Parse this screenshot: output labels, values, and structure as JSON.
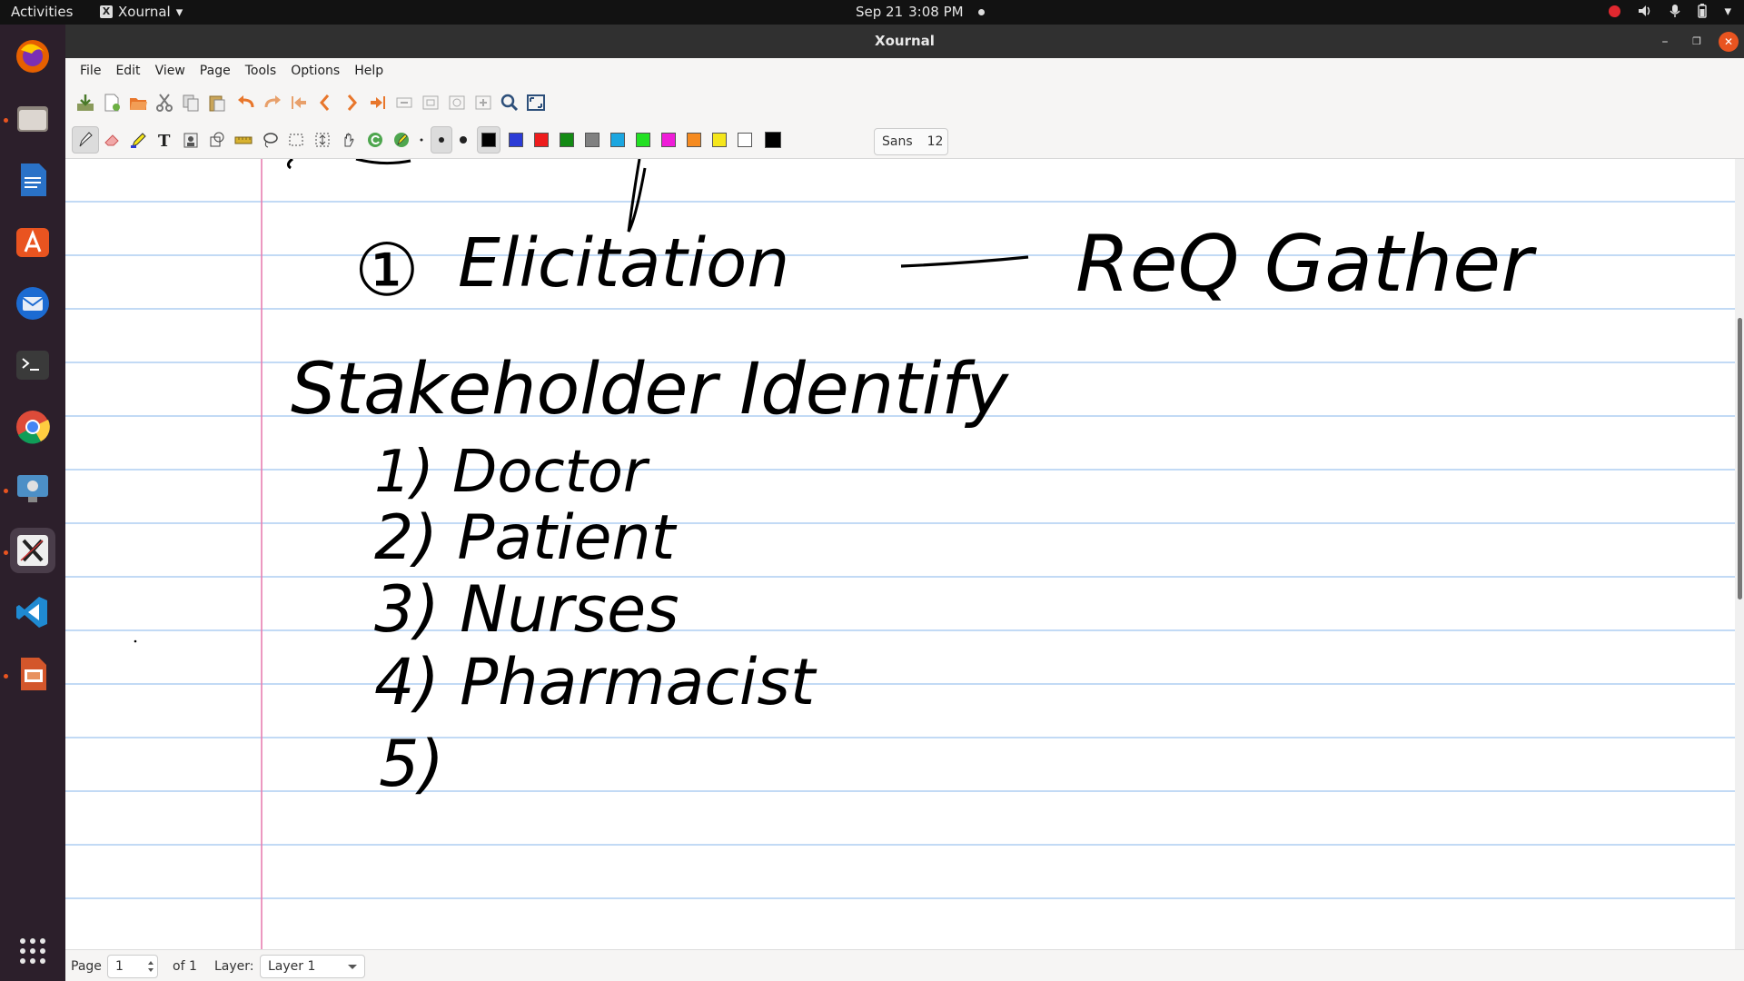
{
  "topbar": {
    "activities": "Activities",
    "app_name": "Xournal",
    "app_menu_arrow": "▾",
    "date": "Sep 21",
    "time": "3:08 PM",
    "tray_menu_arrow": "▾"
  },
  "dock": {
    "items": [
      {
        "name": "firefox",
        "color": "#e66000"
      },
      {
        "name": "files",
        "color": "#9a8f86"
      },
      {
        "name": "libreoffice-writer",
        "color": "#2a72c7"
      },
      {
        "name": "ubuntu-software",
        "color": "#e95420"
      },
      {
        "name": "thunderbird",
        "color": "#1c6bd2"
      },
      {
        "name": "terminal",
        "color": "#3a3a3a"
      },
      {
        "name": "chrome",
        "color": "#dd4b39"
      },
      {
        "name": "screen-recorder",
        "color": "#4c8fc6"
      },
      {
        "name": "xournal",
        "color": "#eeeeee"
      },
      {
        "name": "vscode",
        "color": "#1f8ad2"
      },
      {
        "name": "libreoffice-impress",
        "color": "#d3562b"
      }
    ],
    "apps_grid_glyph": "⋮⋮⋮"
  },
  "window": {
    "title": "Xournal",
    "minimize": "–",
    "maximize": "❐",
    "close": "✕"
  },
  "menu": [
    "File",
    "Edit",
    "View",
    "Page",
    "Tools",
    "Options",
    "Help"
  ],
  "font": {
    "name": "Sans",
    "size": "12"
  },
  "palette": [
    "#000000",
    "#2b3bd6",
    "#ee1c1c",
    "#138a13",
    "#808080",
    "#1ba6e0",
    "#22e022",
    "#ef1cd8",
    "#f58a1f",
    "#f5e61b",
    "#ffffff",
    "#000000"
  ],
  "colors": {
    "ruled_line": "#9dc3ef",
    "margin_line": "#e77fb1",
    "ink": "#000000"
  },
  "handwriting": {
    "line1_number": "①",
    "line1_left": "Elicitation",
    "line1_dash": "——",
    "line1_right": "ReQ Gather",
    "line2": "Stakeholder Identify",
    "item1": "1) Doctor",
    "item2": "2) Patient",
    "item3": "3) Nurses",
    "item4": "4) Pharmacist",
    "item5": "5)"
  },
  "status": {
    "page_label": "Page",
    "page_value": "1",
    "page_of": "of 1",
    "layer_label": "Layer:",
    "layer_value": "Layer 1"
  }
}
